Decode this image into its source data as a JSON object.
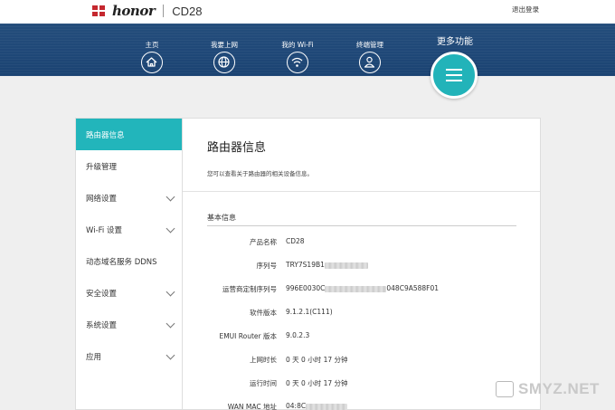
{
  "header": {
    "brand": "honor",
    "model": "CD28",
    "logout": "退出登录"
  },
  "nav": {
    "items": [
      {
        "label": "主页",
        "icon": "home-icon"
      },
      {
        "label": "我要上网",
        "icon": "globe-icon"
      },
      {
        "label": "我的 Wi-Fi",
        "icon": "wifi-icon"
      },
      {
        "label": "终端管理",
        "icon": "user-icon"
      }
    ],
    "more_label": "更多功能",
    "more_icon": "menu-icon",
    "accent_color": "#22b5bb",
    "band_color": "#1f4878"
  },
  "sidebar": {
    "items": [
      {
        "label": "路由器信息",
        "active": true,
        "expandable": false
      },
      {
        "label": "升级管理",
        "active": false,
        "expandable": false
      },
      {
        "label": "网络设置",
        "active": false,
        "expandable": true
      },
      {
        "label": "Wi-Fi 设置",
        "active": false,
        "expandable": true
      },
      {
        "label": "动态域名服务 DDNS",
        "active": false,
        "expandable": false
      },
      {
        "label": "安全设置",
        "active": false,
        "expandable": true
      },
      {
        "label": "系统设置",
        "active": false,
        "expandable": true
      },
      {
        "label": "应用",
        "active": false,
        "expandable": true
      }
    ]
  },
  "main": {
    "title": "路由器信息",
    "description": "您可以查看关于路由器的相关设备信息。",
    "section_title": "基本信息",
    "rows": [
      {
        "label": "产品名称",
        "value": "CD28",
        "redacted": false
      },
      {
        "label": "序列号",
        "value": "TRY7S19B1",
        "redacted": true
      },
      {
        "label": "运营商定制序列号",
        "value": "996E0030C",
        "value_suffix": "048C9A588F01",
        "redacted": true
      },
      {
        "label": "软件版本",
        "value": "9.1.2.1(C111)",
        "redacted": false
      },
      {
        "label": "EMUI Router 版本",
        "value": "9.0.2.3",
        "redacted": false
      },
      {
        "label": "上网时长",
        "value": "0 天 0 小时 17 分钟",
        "redacted": false
      },
      {
        "label": "运行时间",
        "value": "0 天 0 小时 17 分钟",
        "redacted": false
      },
      {
        "label": "WAN MAC 地址",
        "value": "04:8C",
        "redacted": true
      }
    ]
  },
  "watermark": {
    "text": "SMYZ.NET"
  }
}
